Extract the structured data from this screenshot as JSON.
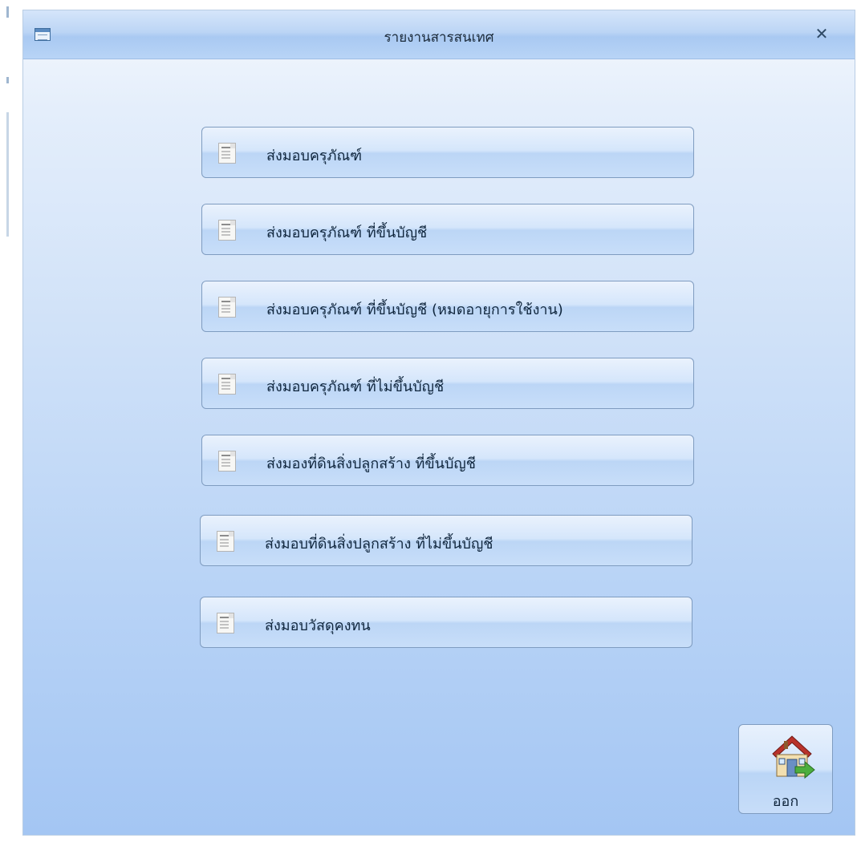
{
  "dialog": {
    "title": "รายงานสารสนเทศ",
    "close_symbol": "✕"
  },
  "reports": [
    {
      "label": "ส่งมอบครุภัณฑ์"
    },
    {
      "label": "ส่งมอบครุภัณฑ์ ที่ขึ้นบัญชี"
    },
    {
      "label": "ส่งมอบครุภัณฑ์ ที่ขึ้นบัญชี (หมดอายุการใช้งาน)"
    },
    {
      "label": "ส่งมอบครุภัณฑ์ ที่ไม่ขึ้นบัญชี"
    },
    {
      "label": "ส่งมองที่ดินสิ่งปลูกสร้าง ที่ขึ้นบัญชี"
    },
    {
      "label": "ส่งมอบที่ดินสิ่งปลูกสร้าง ที่ไม่ขึ้นบัญชี"
    },
    {
      "label": "ส่งมอบวัสดุคงทน"
    }
  ],
  "exit": {
    "label": "ออก",
    "icon": "home-exit-icon"
  },
  "colors": {
    "accent": "#a4c6f3",
    "border": "#7f9cc0"
  }
}
